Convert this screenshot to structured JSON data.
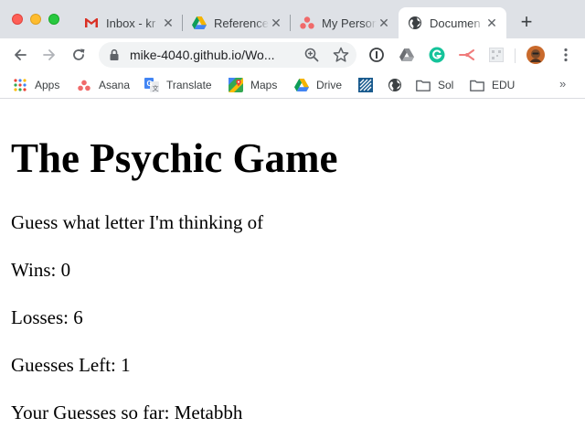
{
  "browser": {
    "tabs": [
      {
        "title": "Inbox - kr",
        "icon": "gmail-icon",
        "active": false
      },
      {
        "title": "Reference",
        "icon": "google-drive-icon",
        "active": false
      },
      {
        "title": "My Person",
        "icon": "asana-icon",
        "active": false
      },
      {
        "title": "Documen",
        "icon": "globe-icon",
        "active": true
      }
    ],
    "address_bar": {
      "url": "mike-4040.github.io/Wo..."
    },
    "bookmarks": [
      {
        "label": "Apps",
        "icon": "apps-grid-icon"
      },
      {
        "label": "Asana",
        "icon": "asana-icon"
      },
      {
        "label": "Translate",
        "icon": "google-translate-icon"
      },
      {
        "label": "Maps",
        "icon": "google-maps-icon"
      },
      {
        "label": "Drive",
        "icon": "google-drive-icon"
      },
      {
        "label": "",
        "icon": "bookmark-stripes-icon"
      },
      {
        "label": "",
        "icon": "globe-icon"
      },
      {
        "label": "Sol",
        "icon": "folder-icon"
      },
      {
        "label": "EDU",
        "icon": "folder-icon"
      }
    ],
    "bookmarks_overflow": "»",
    "colors": {
      "tabstrip": "#dee1e6",
      "omnibox": "#f1f3f4",
      "asana": "#f06a6a",
      "drive_green": "#0f9d58",
      "drive_yellow": "#f4b400",
      "drive_blue": "#4285f4"
    }
  },
  "page": {
    "heading": "The Psychic Game",
    "instruction": "Guess what letter I'm thinking of",
    "wins": "Wins: 0",
    "losses": "Losses: 6",
    "guesses_left": "Guesses Left: 1",
    "guesses_so_far": "Your Guesses so far: Metabbh"
  }
}
